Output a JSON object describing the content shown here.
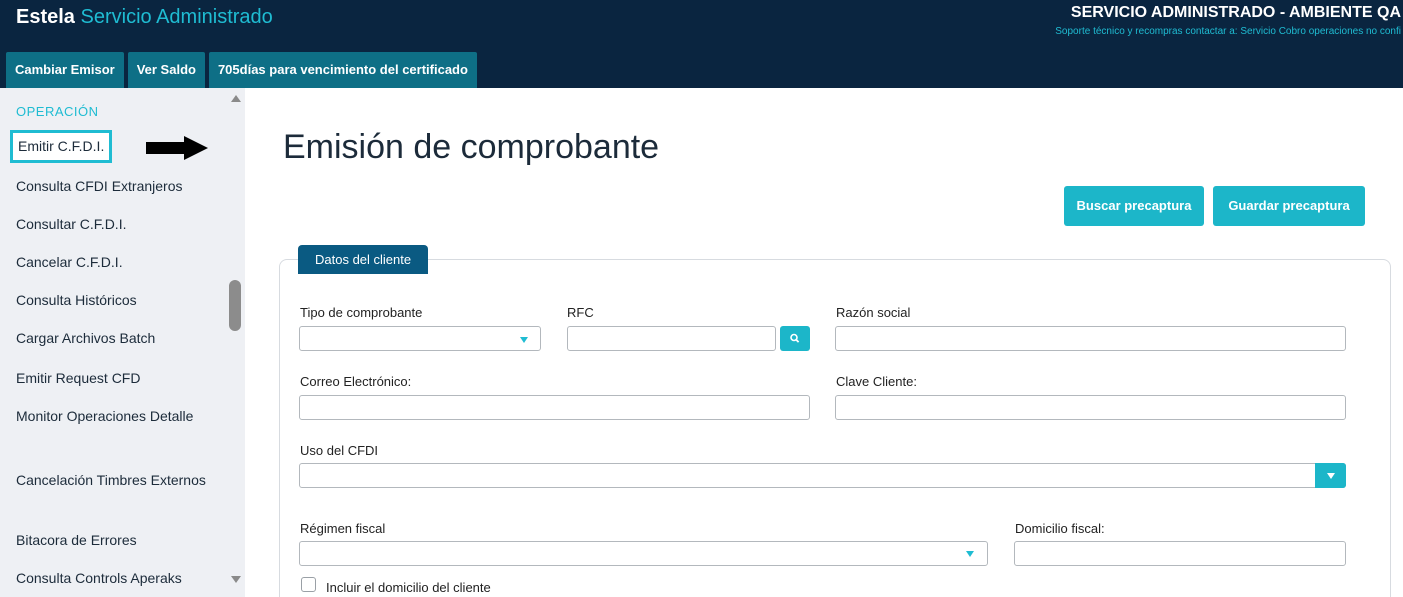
{
  "header": {
    "brand_bold": "Estela",
    "brand_sub": "Servicio Administrado",
    "env_title": "SERVICIO ADMINISTRADO - AMBIENTE QA",
    "support_text": "Soporte técnico y recompras contactar a: Servicio Cobro operaciones no confi",
    "tabs": [
      {
        "label": "Cambiar Emisor"
      },
      {
        "label": "Ver Saldo"
      },
      {
        "label": "705días para vencimiento del certificado"
      }
    ]
  },
  "sidebar": {
    "section": "OPERACIÓN",
    "items": [
      {
        "label": "Emitir C.F.D.I."
      },
      {
        "label": "Consulta CFDI Extranjeros"
      },
      {
        "label": "Consultar C.F.D.I."
      },
      {
        "label": "Cancelar C.F.D.I."
      },
      {
        "label": "Consulta Históricos"
      },
      {
        "label": "Cargar Archivos Batch"
      },
      {
        "label": "Emitir Request CFD"
      },
      {
        "label": "Monitor Operaciones Detalle"
      },
      {
        "label": "Cancelación Timbres Externos"
      },
      {
        "label": "Bitacora de Errores"
      },
      {
        "label": "Consulta Controls Aperaks"
      }
    ]
  },
  "main": {
    "title": "Emisión de comprobante",
    "buttons": {
      "buscar": "Buscar precaptura",
      "guardar": "Guardar precaptura"
    },
    "panel_tab": "Datos del cliente",
    "fields": {
      "tipo": {
        "label": "Tipo de comprobante",
        "value": ""
      },
      "rfc": {
        "label": "RFC",
        "value": ""
      },
      "razon": {
        "label": "Razón social",
        "value": ""
      },
      "correo": {
        "label": "Correo Electrónico:",
        "value": ""
      },
      "clave": {
        "label": "Clave Cliente:",
        "value": ""
      },
      "uso": {
        "label": "Uso del CFDI",
        "value": ""
      },
      "regimen": {
        "label": "Régimen fiscal",
        "value": ""
      },
      "domicilio": {
        "label": "Domicilio fiscal:",
        "value": ""
      },
      "incluir": {
        "label": "Incluir el domicilio del cliente",
        "checked": false
      }
    }
  },
  "colors": {
    "header_bg": "#0a2540",
    "accent": "#1cb6c9",
    "tab_bg": "#0e6f86",
    "panel_tab_bg": "#0a5a82",
    "sidebar_bg": "#eef0f4"
  }
}
